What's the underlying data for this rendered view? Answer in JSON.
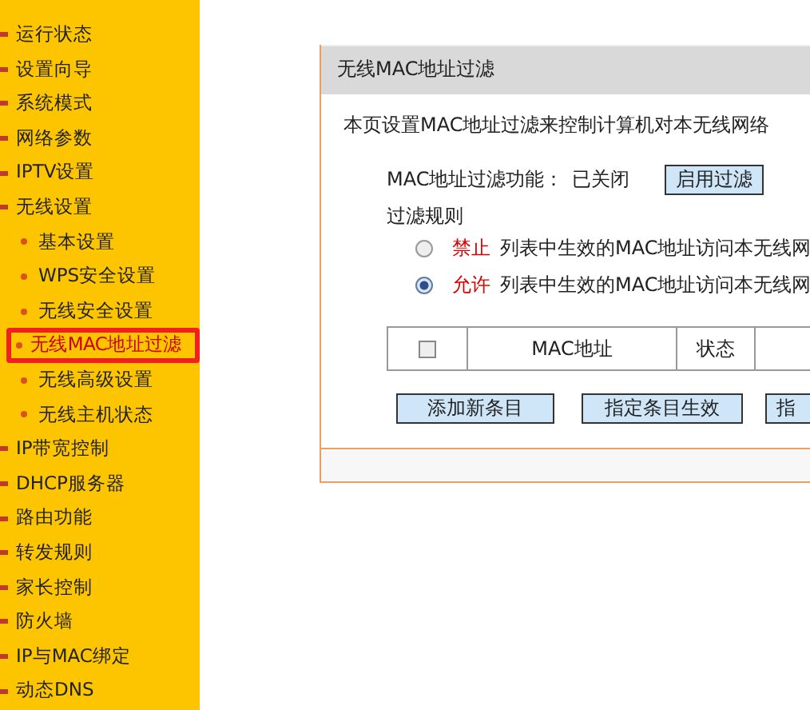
{
  "sidebar": {
    "items": [
      {
        "label": "运行状态",
        "selected": false
      },
      {
        "label": "设置向导",
        "selected": false
      },
      {
        "label": "系统模式",
        "selected": false
      },
      {
        "label": "网络参数",
        "selected": false
      },
      {
        "label": "IPTV设置",
        "selected": false
      },
      {
        "label": "无线设置",
        "selected": false,
        "children": [
          {
            "label": "基本设置",
            "selected": false
          },
          {
            "label": "WPS安全设置",
            "selected": false
          },
          {
            "label": "无线安全设置",
            "selected": false
          },
          {
            "label": "无线MAC地址过滤",
            "selected": true
          },
          {
            "label": "无线高级设置",
            "selected": false
          },
          {
            "label": "无线主机状态",
            "selected": false
          }
        ]
      },
      {
        "label": "IP带宽控制",
        "selected": false
      },
      {
        "label": "DHCP服务器",
        "selected": false
      },
      {
        "label": "路由功能",
        "selected": false
      },
      {
        "label": "转发规则",
        "selected": false
      },
      {
        "label": "家长控制",
        "selected": false
      },
      {
        "label": "防火墙",
        "selected": false
      },
      {
        "label": "IP与MAC绑定",
        "selected": false
      },
      {
        "label": "动态DNS",
        "selected": false
      }
    ]
  },
  "panel": {
    "title": "无线MAC地址过滤",
    "description": "本页设置MAC地址过滤来控制计算机对本无线网络",
    "filter_function": {
      "label": "MAC地址过滤功能：",
      "status": "已关闭",
      "button": "启用过滤"
    },
    "rules_label": "过滤规则",
    "rules": [
      {
        "keyword": "禁止",
        "text": "列表中生效的MAC地址访问本无线网",
        "selected": false
      },
      {
        "keyword": "允许",
        "text": "列表中生效的MAC地址访问本无线网",
        "selected": true
      }
    ],
    "table": {
      "select_all": {
        "checked": false
      },
      "columns": [
        "MAC地址",
        "状态"
      ]
    },
    "buttons": [
      "添加新条目",
      "指定条目生效",
      "指"
    ]
  }
}
